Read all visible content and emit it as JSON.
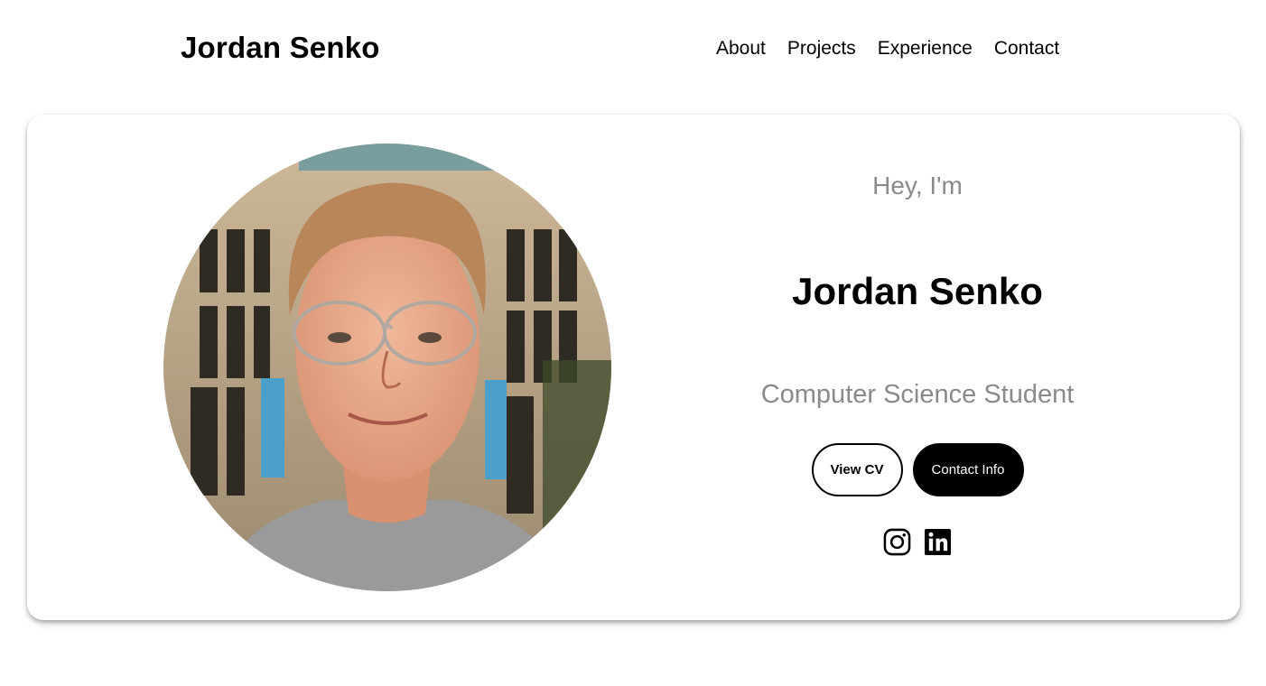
{
  "nav": {
    "logo": "Jordan Senko",
    "links": [
      "About",
      "Projects",
      "Experience",
      "Contact"
    ]
  },
  "hero": {
    "greeting": "Hey, I'm",
    "name": "Jordan Senko",
    "role": "Computer Science Student",
    "buttons": {
      "cv": "View CV",
      "contact": "Contact Info"
    },
    "socials": [
      {
        "icon": "instagram-icon"
      },
      {
        "icon": "linkedin-icon"
      }
    ]
  },
  "colors": {
    "text": "#000000",
    "muted": "#8a8a8a",
    "background": "#ffffff"
  }
}
